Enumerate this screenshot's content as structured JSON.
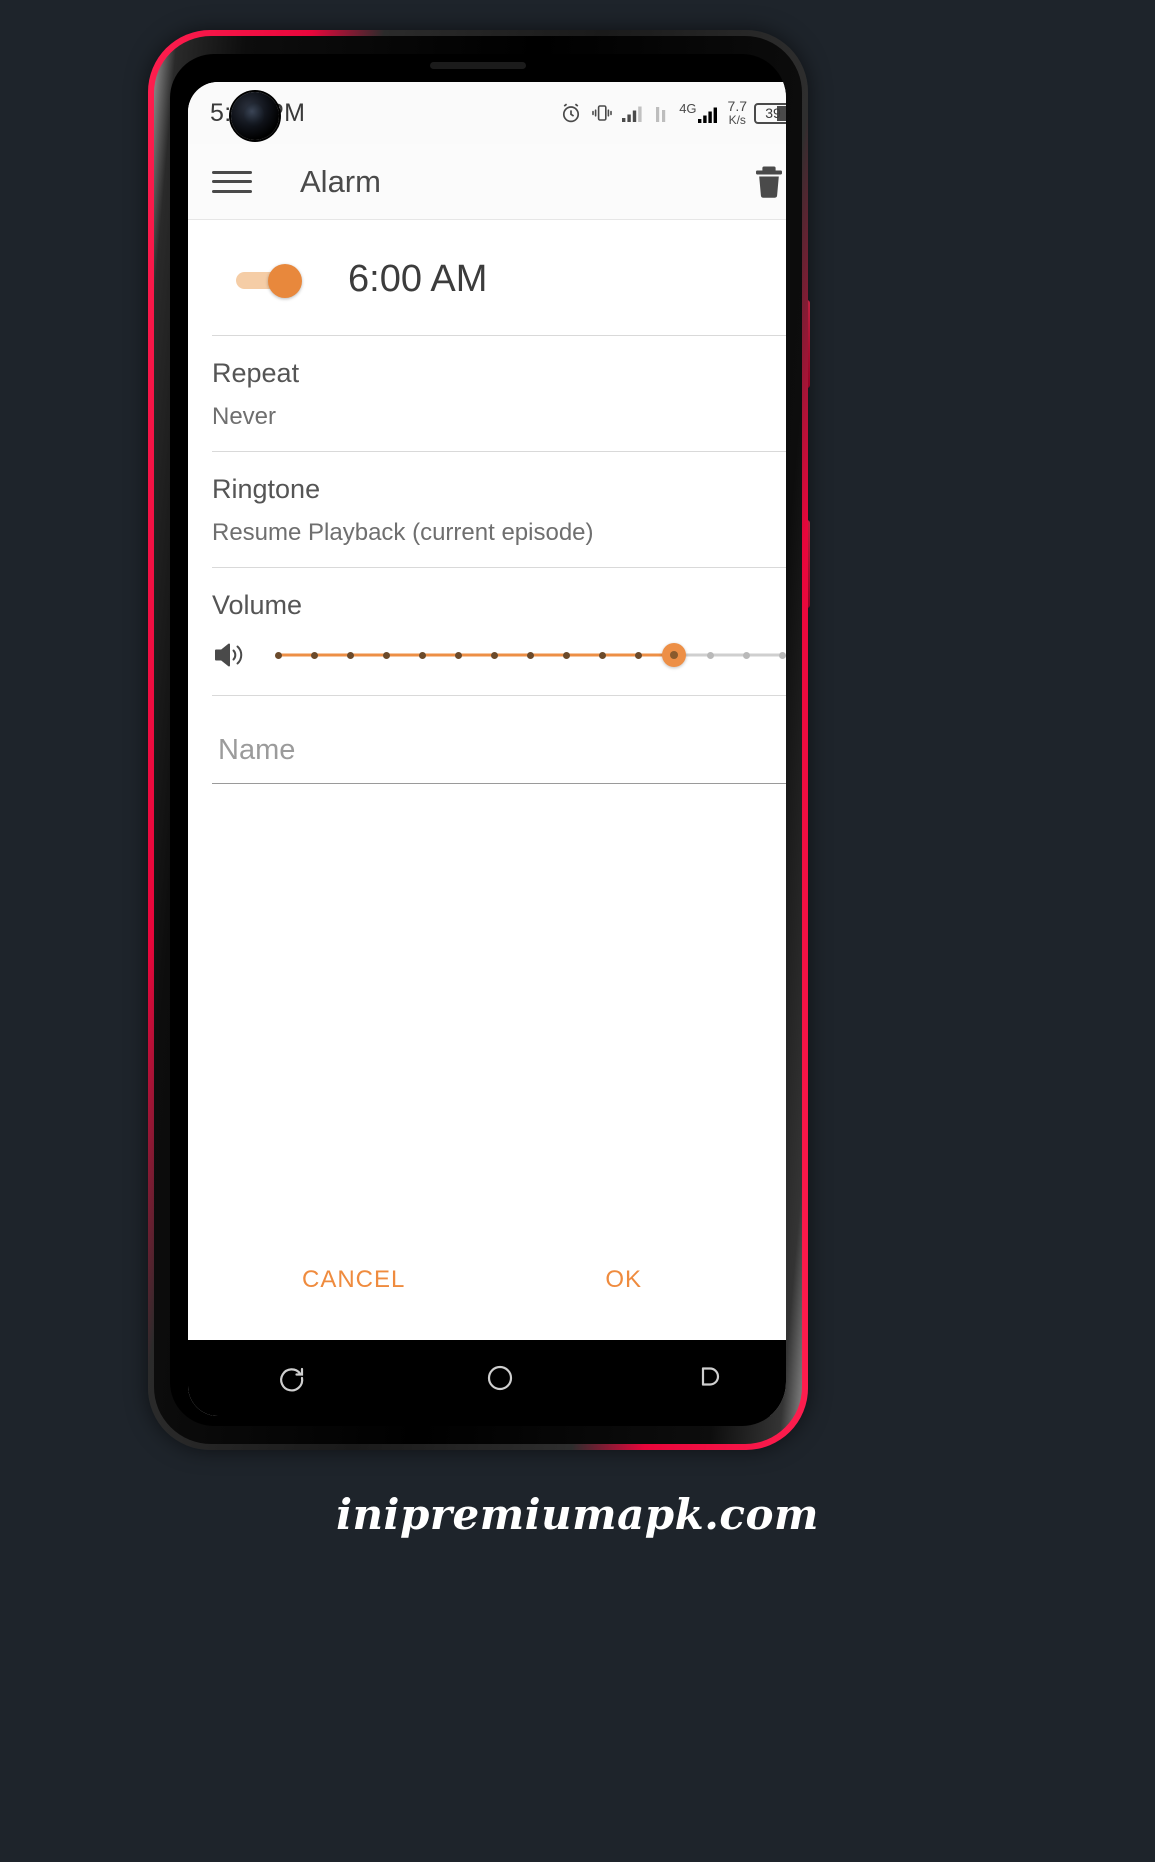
{
  "status_bar": {
    "time": "5:00 PM",
    "alarm_icon": "alarm-clock-icon",
    "vibrate_icon": "vibrate-icon",
    "signal_icon": "signal-bars-icon",
    "sim2_icon": "sim-signal-icon",
    "network_type": "4G",
    "data_speed_value": "7.7",
    "data_speed_unit": "K/s",
    "battery_percent": "39"
  },
  "app_bar": {
    "menu_icon": "hamburger-menu-icon",
    "title": "Alarm",
    "delete_icon": "trash-icon"
  },
  "alarm": {
    "enabled_toggle": "alarm-enabled-toggle",
    "time": "6:00 AM",
    "repeat": {
      "label": "Repeat",
      "value": "Never"
    },
    "ringtone": {
      "label": "Ringtone",
      "value": "Resume Playback (current episode)"
    },
    "volume": {
      "label": "Volume",
      "icon": "speaker-volume-icon",
      "value": 11,
      "min": 0,
      "max": 14,
      "ticks": 15,
      "filled_color": "#ed8f46",
      "empty_color": "#b9b9b9"
    },
    "name": {
      "value": "",
      "placeholder": "Name"
    }
  },
  "actions": {
    "cancel_label": "CANCEL",
    "ok_label": "OK",
    "accent_color": "#ef8b3e"
  },
  "nav_bar": {
    "recents_icon": "recents-icon",
    "home_icon": "home-circle-icon",
    "back_icon": "back-icon"
  },
  "watermark": {
    "text": "inipremiumapk.com"
  }
}
